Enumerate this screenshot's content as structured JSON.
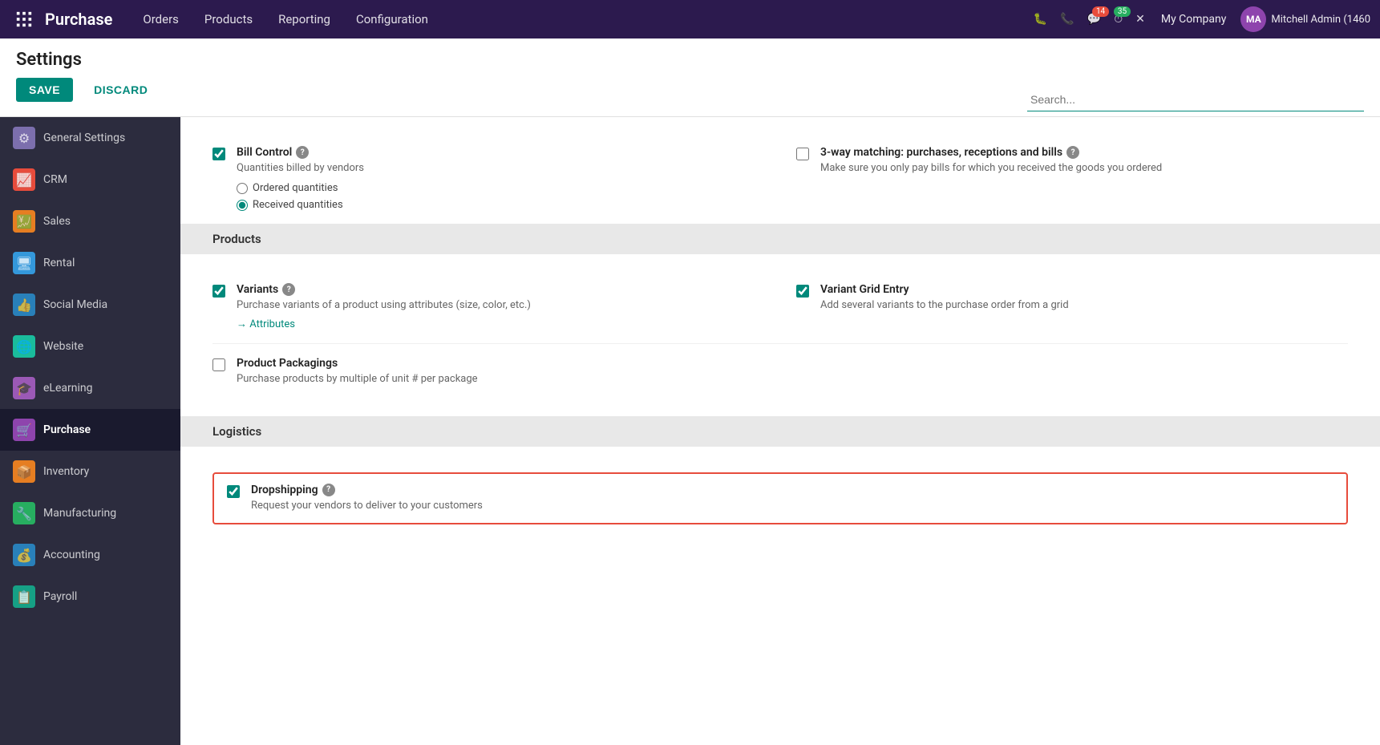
{
  "topnav": {
    "brand": "Purchase",
    "menu": [
      "Orders",
      "Products",
      "Reporting",
      "Configuration"
    ],
    "icons": {
      "bug": "🐞",
      "phone": "📞",
      "chat_badge": "14",
      "timer_badge": "35"
    },
    "company": "My Company",
    "user": "Mitchell Admin (1460"
  },
  "page": {
    "title": "Settings",
    "save_label": "SAVE",
    "discard_label": "DISCARD"
  },
  "search": {
    "placeholder": "Search..."
  },
  "sidebar": {
    "items": [
      {
        "id": "general-settings",
        "label": "General Settings",
        "icon": "⚙"
      },
      {
        "id": "crm",
        "label": "CRM",
        "icon": "📈"
      },
      {
        "id": "sales",
        "label": "Sales",
        "icon": "💹"
      },
      {
        "id": "rental",
        "label": "Rental",
        "icon": "🖥"
      },
      {
        "id": "social-media",
        "label": "Social Media",
        "icon": "👍"
      },
      {
        "id": "website",
        "label": "Website",
        "icon": "🌐"
      },
      {
        "id": "elearning",
        "label": "eLearning",
        "icon": "🎓"
      },
      {
        "id": "purchase",
        "label": "Purchase",
        "icon": "🛒",
        "active": true
      },
      {
        "id": "inventory",
        "label": "Inventory",
        "icon": "📦"
      },
      {
        "id": "manufacturing",
        "label": "Manufacturing",
        "icon": "🔧"
      },
      {
        "id": "accounting",
        "label": "Accounting",
        "icon": "💰"
      },
      {
        "id": "payroll",
        "label": "Payroll",
        "icon": "📋"
      }
    ]
  },
  "content": {
    "bill_control": {
      "label": "Bill Control",
      "description": "Quantities billed by vendors",
      "checked": true,
      "radio_options": [
        {
          "id": "ordered-qty",
          "label": "Ordered quantities",
          "checked": false
        },
        {
          "id": "received-qty",
          "label": "Received quantities",
          "checked": true
        }
      ]
    },
    "three_way_matching": {
      "label": "3-way matching: purchases, receptions and bills",
      "description": "Make sure you only pay bills for which you received the goods you ordered"
    },
    "products_section": "Products",
    "variants": {
      "label": "Variants",
      "description": "Purchase variants of a product using attributes (size, color, etc.)",
      "link": "→ Attributes",
      "checked": true
    },
    "variant_grid_entry": {
      "label": "Variant Grid Entry",
      "description": "Add several variants to the purchase order from a grid",
      "checked": true
    },
    "product_packagings": {
      "label": "Product Packagings",
      "description": "Purchase products by multiple of unit # per package",
      "checked": false
    },
    "logistics_section": "Logistics",
    "dropshipping": {
      "label": "Dropshipping",
      "description": "Request your vendors to deliver to your customers",
      "checked": true,
      "highlighted": true
    }
  }
}
